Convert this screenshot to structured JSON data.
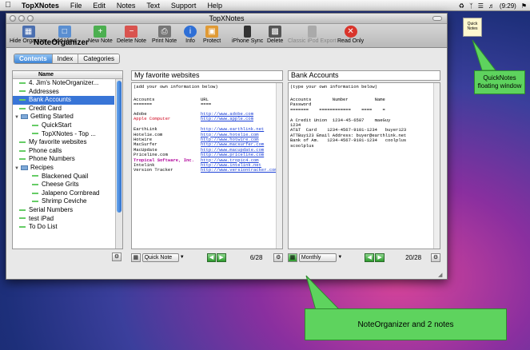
{
  "menubar": {
    "app": "TopXNotes",
    "items": [
      "File",
      "Edit",
      "Notes",
      "Text",
      "Support",
      "Help"
    ],
    "battery": "(9:29)"
  },
  "window": {
    "title": "TopXNotes",
    "toolbar": [
      {
        "label": "Hide Organizer",
        "icon": "organizer-icon",
        "color": "#4b6fb0"
      },
      {
        "label": "Add View",
        "icon": "add-view-icon",
        "color": "#5b8fd1"
      },
      {
        "label": "New Note",
        "icon": "new-note-icon",
        "color": "#4caf50"
      },
      {
        "label": "Delete Note",
        "icon": "delete-note-icon",
        "color": "#d9534f"
      },
      {
        "label": "Print Note",
        "icon": "printer-icon",
        "color": "#777777"
      },
      {
        "label": "Info",
        "icon": "info-icon",
        "color": "#2f6fd6"
      },
      {
        "label": "Protect",
        "icon": "lock-icon",
        "color": "#e09a35"
      },
      {
        "label": "iPhone Sync",
        "icon": "iphone-icon",
        "color": "#333333"
      },
      {
        "label": "Delete",
        "icon": "trash-icon",
        "color": "#555555"
      },
      {
        "label": "Classic iPod Export",
        "icon": "ipod-icon",
        "color": "#aaaaaa"
      },
      {
        "label": "Read Only",
        "icon": "read-only-icon",
        "color": "#d9342b"
      }
    ]
  },
  "organizer": {
    "title": "NoteOrganizer",
    "tabs": [
      "Contents",
      "Index",
      "Categories"
    ],
    "column": "Name",
    "items": [
      {
        "label": "4. Jim's NoteOrganizer...",
        "type": "note"
      },
      {
        "label": "Addresses",
        "type": "note"
      },
      {
        "label": "Bank Accounts",
        "type": "note",
        "selected": true
      },
      {
        "label": "Credit Card",
        "type": "note"
      },
      {
        "label": "Getting Started",
        "type": "folder"
      },
      {
        "label": "QuickStart",
        "type": "note",
        "indent": 1
      },
      {
        "label": "TopXNotes - Top ...",
        "type": "note",
        "indent": 1
      },
      {
        "label": "My favorite websites",
        "type": "note"
      },
      {
        "label": "Phone calls",
        "type": "note"
      },
      {
        "label": "Phone Numbers",
        "type": "note"
      },
      {
        "label": "Recipes",
        "type": "folder"
      },
      {
        "label": "Blackened Quail",
        "type": "note",
        "indent": 1
      },
      {
        "label": "Cheese Grits",
        "type": "note",
        "indent": 1
      },
      {
        "label": "Jalapeno Cornbread",
        "type": "note",
        "indent": 1
      },
      {
        "label": "Shrimp Ceviche",
        "type": "note",
        "indent": 1
      },
      {
        "label": "Serial Numbers",
        "type": "note"
      },
      {
        "label": "test iPad",
        "type": "note"
      },
      {
        "label": "To Do List",
        "type": "note"
      }
    ]
  },
  "note1": {
    "title": "My favorite websites",
    "intro": "(add your own information below)",
    "col_a": "Accounts",
    "col_b": "URL",
    "rows": [
      {
        "name": "Adobe",
        "url": "http://www.adobe.com"
      },
      {
        "name": "Apple Computer",
        "url": "http://www.apple.com"
      },
      {
        "name": "EarthLink",
        "url": "http://www.earthlink.net"
      },
      {
        "name": "Hotelie.com",
        "url": "http://www.hotelie.com"
      },
      {
        "name": "Hotwire",
        "url": "http://www.hotwire.com"
      },
      {
        "name": "MacSurfer",
        "url": "http://www.macsurfer.com"
      },
      {
        "name": "MacUpdate",
        "url": "http://www.macupdate.com"
      },
      {
        "name": "Priceline.com",
        "url": "http://www.priceline.com"
      },
      {
        "name": "Tropical Software, Inc.",
        "url": "http://www.tropic4.com"
      },
      {
        "name": "Intelink",
        "url": "http://www.intelink.net"
      },
      {
        "name": "Version Tracker",
        "url": "http://www.versiontracker.com"
      }
    ],
    "category": "Quick Note",
    "count": "6/28"
  },
  "note2": {
    "title": "Bank Accounts",
    "intro": "(type your own information below)",
    "lines": [
      "Accounts        Number          Name",
      "Password",
      "=======    ============    ====    =",
      "",
      "A Credit Union  1234-45-6587    maeGuy",
      "1234",
      "AT&T  Card    1234-4567-9101-1234   buyer123",
      "ATTBuy123 Email Address: buyer@earthlink.net",
      "Bank of Am.   1234-4567-9101-1234   coolplus",
      "scoolplus"
    ],
    "category": "Monthly",
    "count": "20/28"
  },
  "floating": {
    "label": "Quick Notes"
  },
  "callouts": {
    "quicknotes": "QuickNotes floating window",
    "main": "NoteOrganizer and 2 notes"
  }
}
